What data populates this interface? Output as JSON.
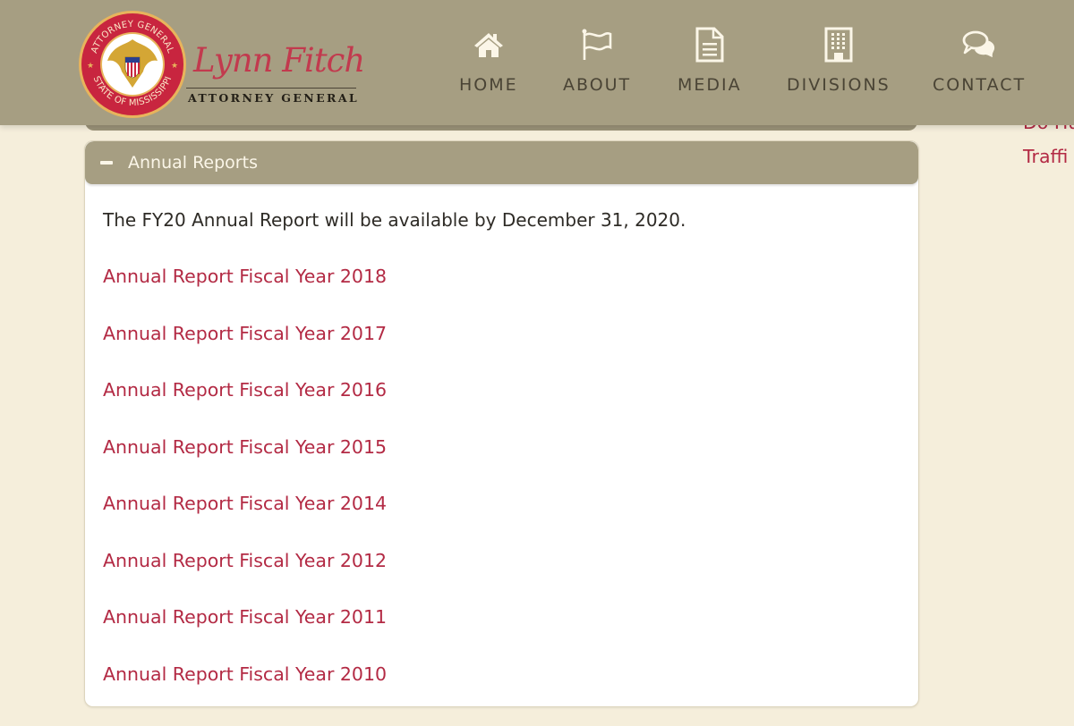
{
  "header": {
    "logo": {
      "seal_top_text": "ATTORNEY GENERAL",
      "seal_bottom_text": "STATE OF MISSISSIPPI",
      "name": "Lynn Fitch",
      "title": "ATTORNEY GENERAL"
    },
    "nav": [
      {
        "label": "HOME",
        "icon": "home-icon"
      },
      {
        "label": "ABOUT",
        "icon": "flag-icon"
      },
      {
        "label": "MEDIA",
        "icon": "document-icon"
      },
      {
        "label": "DIVISIONS",
        "icon": "building-icon"
      },
      {
        "label": "CONTACT",
        "icon": "chat-bubbles-icon"
      }
    ]
  },
  "accordion": {
    "title": "Annual Reports",
    "expanded_icon": "minus-icon",
    "notice": "The FY20 Annual Report will be available by December 31, 2020.",
    "reports": [
      {
        "label": "Annual Report Fiscal Year 2018"
      },
      {
        "label": "Annual Report Fiscal Year 2017"
      },
      {
        "label": "Annual Report Fiscal Year 2016"
      },
      {
        "label": "Annual Report Fiscal Year 2015"
      },
      {
        "label": "Annual Report Fiscal Year 2014"
      },
      {
        "label": "Annual Report Fiscal Year 2012"
      },
      {
        "label": "Annual Report Fiscal Year 2011"
      },
      {
        "label": "Annual Report Fiscal Year 2010"
      }
    ]
  },
  "sidebar": {
    "links": [
      {
        "label": "Do Hu"
      },
      {
        "label": "Traffi"
      }
    ]
  },
  "colors": {
    "header_bg": "#a69e82",
    "page_bg": "#f5eedb",
    "link": "#b32a44",
    "nav_text": "#4a4435",
    "icon": "#fbf6e8"
  }
}
